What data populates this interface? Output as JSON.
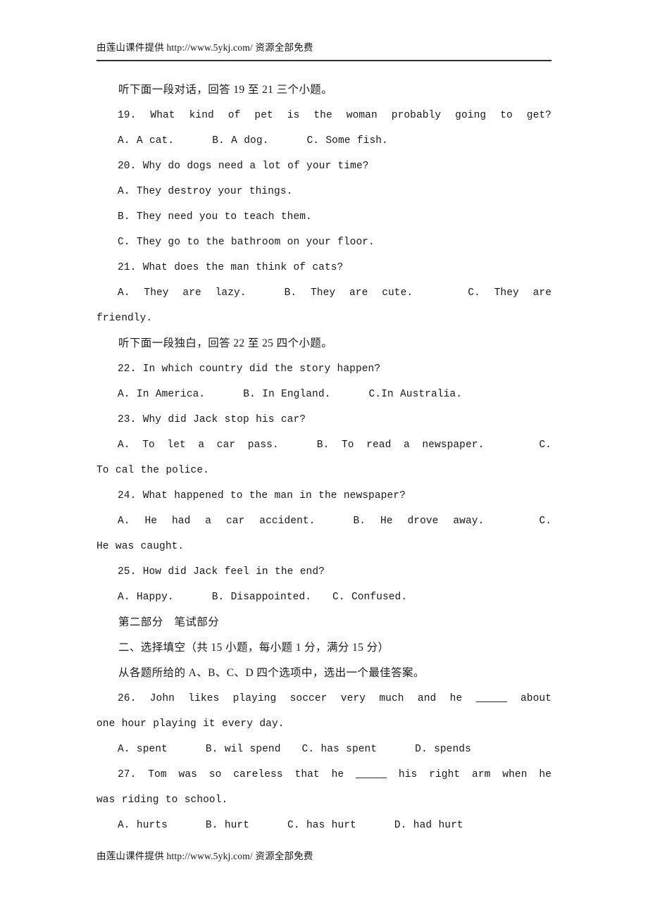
{
  "header": {
    "text": "由莲山课件提供 http://www.5ykj.com/   资源全部免费"
  },
  "footer": {
    "text": "由莲山课件提供 http://www.5ykj.com/   资源全部免费"
  },
  "listening": {
    "dialogue_intro": "听下面一段对话，回答 19 至 21 三个小题。",
    "monologue_intro": "听下面一段独白，回答 22 至 25 四个小题。",
    "q19": {
      "stem": "19.  What kind of pet is the woman probably going to get?",
      "a": "A.  A cat.",
      "b": "B.  A dog.",
      "c": "C.  Some fish."
    },
    "q20": {
      "stem": "20.  Why do dogs need a lot of your time?",
      "a": "A.  They destroy your things.",
      "b": "B.  They need you to teach them.",
      "c": "C.  They go to the bathroom on your floor."
    },
    "q21": {
      "stem": "21.  What does the man think of cats?",
      "a": "A.  They are lazy.",
      "b": "B.  They are cute.",
      "c": "C.  They are",
      "c_cont": "friendly."
    },
    "q22": {
      "stem": "22.  In which country did the story happen?",
      "a": "A.  In America.",
      "b": "B.  In England.",
      "c": "C.In Australia."
    },
    "q23": {
      "stem": "23.  Why did Jack stop his car?",
      "a": "A.  To let a car pass.",
      "b": "B.  To read a newspaper.",
      "c": "C.",
      "c_cont": "To cal the police."
    },
    "q24": {
      "stem": "24.  What happened to the man in the newspaper?",
      "a": "A.  He had a car accident.",
      "b": "B.  He drove away.",
      "c": "C.",
      "c_cont": "He was caught."
    },
    "q25": {
      "stem": "25.  How did Jack feel in the end?",
      "a": "A.  Happy.",
      "b": "B.  Disappointed.",
      "c": "C.  Confused."
    }
  },
  "part_two": {
    "part_title": "第二部分　笔试部分",
    "section_title": "二、选择填空（共 15 小题，每小题 1 分，满分 15 分）",
    "instruction": "从各题所给的 A、B、C、D 四个选项中，选出一个最佳答案。",
    "q26": {
      "stem_before": "26.  John likes playing soccer very much and he",
      "stem_after": "about",
      "stem_cont": "one hour playing it every day.",
      "a": "A.  spent",
      "b": "B.  wil spend",
      "c": "C.  has spent",
      "d": "D.  spends"
    },
    "q27": {
      "stem_before": "27.  Tom was so careless that he",
      "stem_after": "his right arm when he",
      "stem_cont": "was riding to school.",
      "a": "A.  hurts",
      "b": "B.  hurt",
      "c": "C.  has hurt",
      "d": "D.  had hurt"
    }
  }
}
